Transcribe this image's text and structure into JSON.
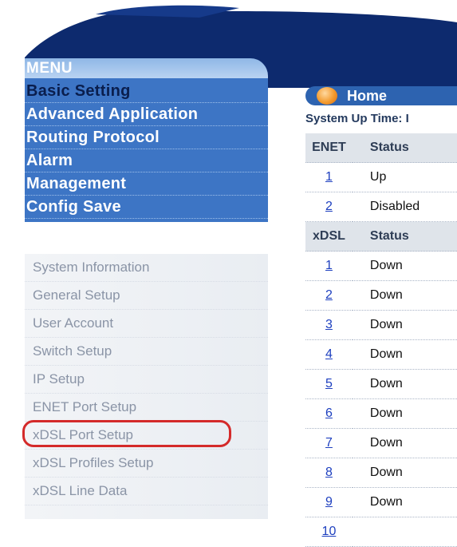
{
  "menu": {
    "title": "MENU",
    "categories": [
      "Basic Setting",
      "Advanced Application",
      "Routing Protocol",
      "Alarm",
      "Management",
      "Config Save"
    ],
    "submenu": [
      "System Information",
      "General Setup",
      "User Account",
      "Switch Setup",
      "IP Setup",
      "ENET Port Setup",
      "xDSL Port Setup",
      "xDSL Profiles Setup",
      "xDSL Line Data"
    ]
  },
  "home": {
    "label": "Home"
  },
  "uptime_label": "System Up Time: I",
  "enet_table": {
    "headers": [
      "ENET",
      "Status"
    ],
    "rows": [
      {
        "port": "1",
        "status": "Up"
      },
      {
        "port": "2",
        "status": "Disabled"
      }
    ]
  },
  "xdsl_table": {
    "headers": [
      "xDSL",
      "Status"
    ],
    "rows": [
      {
        "port": "1",
        "status": "Down"
      },
      {
        "port": "2",
        "status": "Down"
      },
      {
        "port": "3",
        "status": "Down"
      },
      {
        "port": "4",
        "status": "Down"
      },
      {
        "port": "5",
        "status": "Down"
      },
      {
        "port": "6",
        "status": "Down"
      },
      {
        "port": "7",
        "status": "Down"
      },
      {
        "port": "8",
        "status": "Down"
      },
      {
        "port": "9",
        "status": "Down"
      },
      {
        "port": "10",
        "status": ""
      }
    ]
  },
  "colors": {
    "menu_blue": "#3d75c5",
    "dark_navy": "#0d2a6e",
    "highlight_red": "#d42a2a",
    "home_orange": "#f39a2d"
  }
}
